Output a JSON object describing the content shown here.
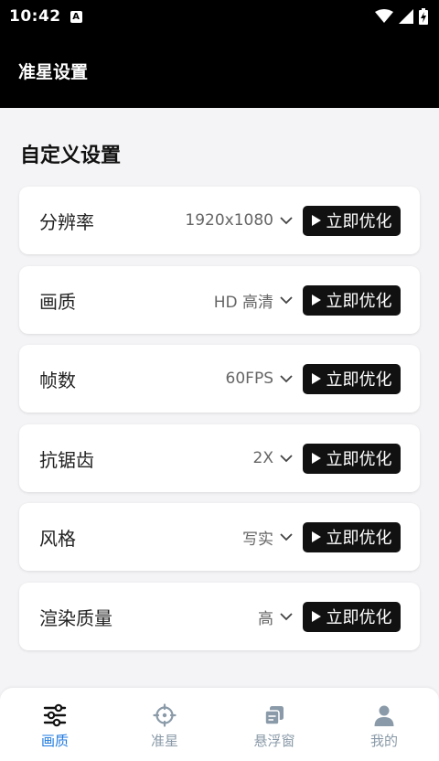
{
  "status": {
    "time": "10:42",
    "badge": "A"
  },
  "appbar": {
    "title": "准星设置"
  },
  "section": {
    "title": "自定义设置"
  },
  "settings": [
    {
      "label": "分辨率",
      "value": "1920x1080",
      "button": "立即优化"
    },
    {
      "label": "画质",
      "value": "HD 高清",
      "button": "立即优化"
    },
    {
      "label": "帧数",
      "value": "60FPS",
      "button": "立即优化"
    },
    {
      "label": "抗锯齿",
      "value": "2X",
      "button": "立即优化"
    },
    {
      "label": "风格",
      "value": "写实",
      "button": "立即优化"
    },
    {
      "label": "渲染质量",
      "value": "高",
      "button": "立即优化"
    }
  ],
  "nav": [
    {
      "label": "画质",
      "icon": "sliders-icon",
      "active": true
    },
    {
      "label": "准星",
      "icon": "crosshair-icon",
      "active": false
    },
    {
      "label": "悬浮窗",
      "icon": "floating-window-icon",
      "active": false
    },
    {
      "label": "我的",
      "icon": "person-icon",
      "active": false
    }
  ],
  "colors": {
    "accent": "#1f7ae0",
    "inactive": "#8a9aa8",
    "button": "#111111"
  }
}
